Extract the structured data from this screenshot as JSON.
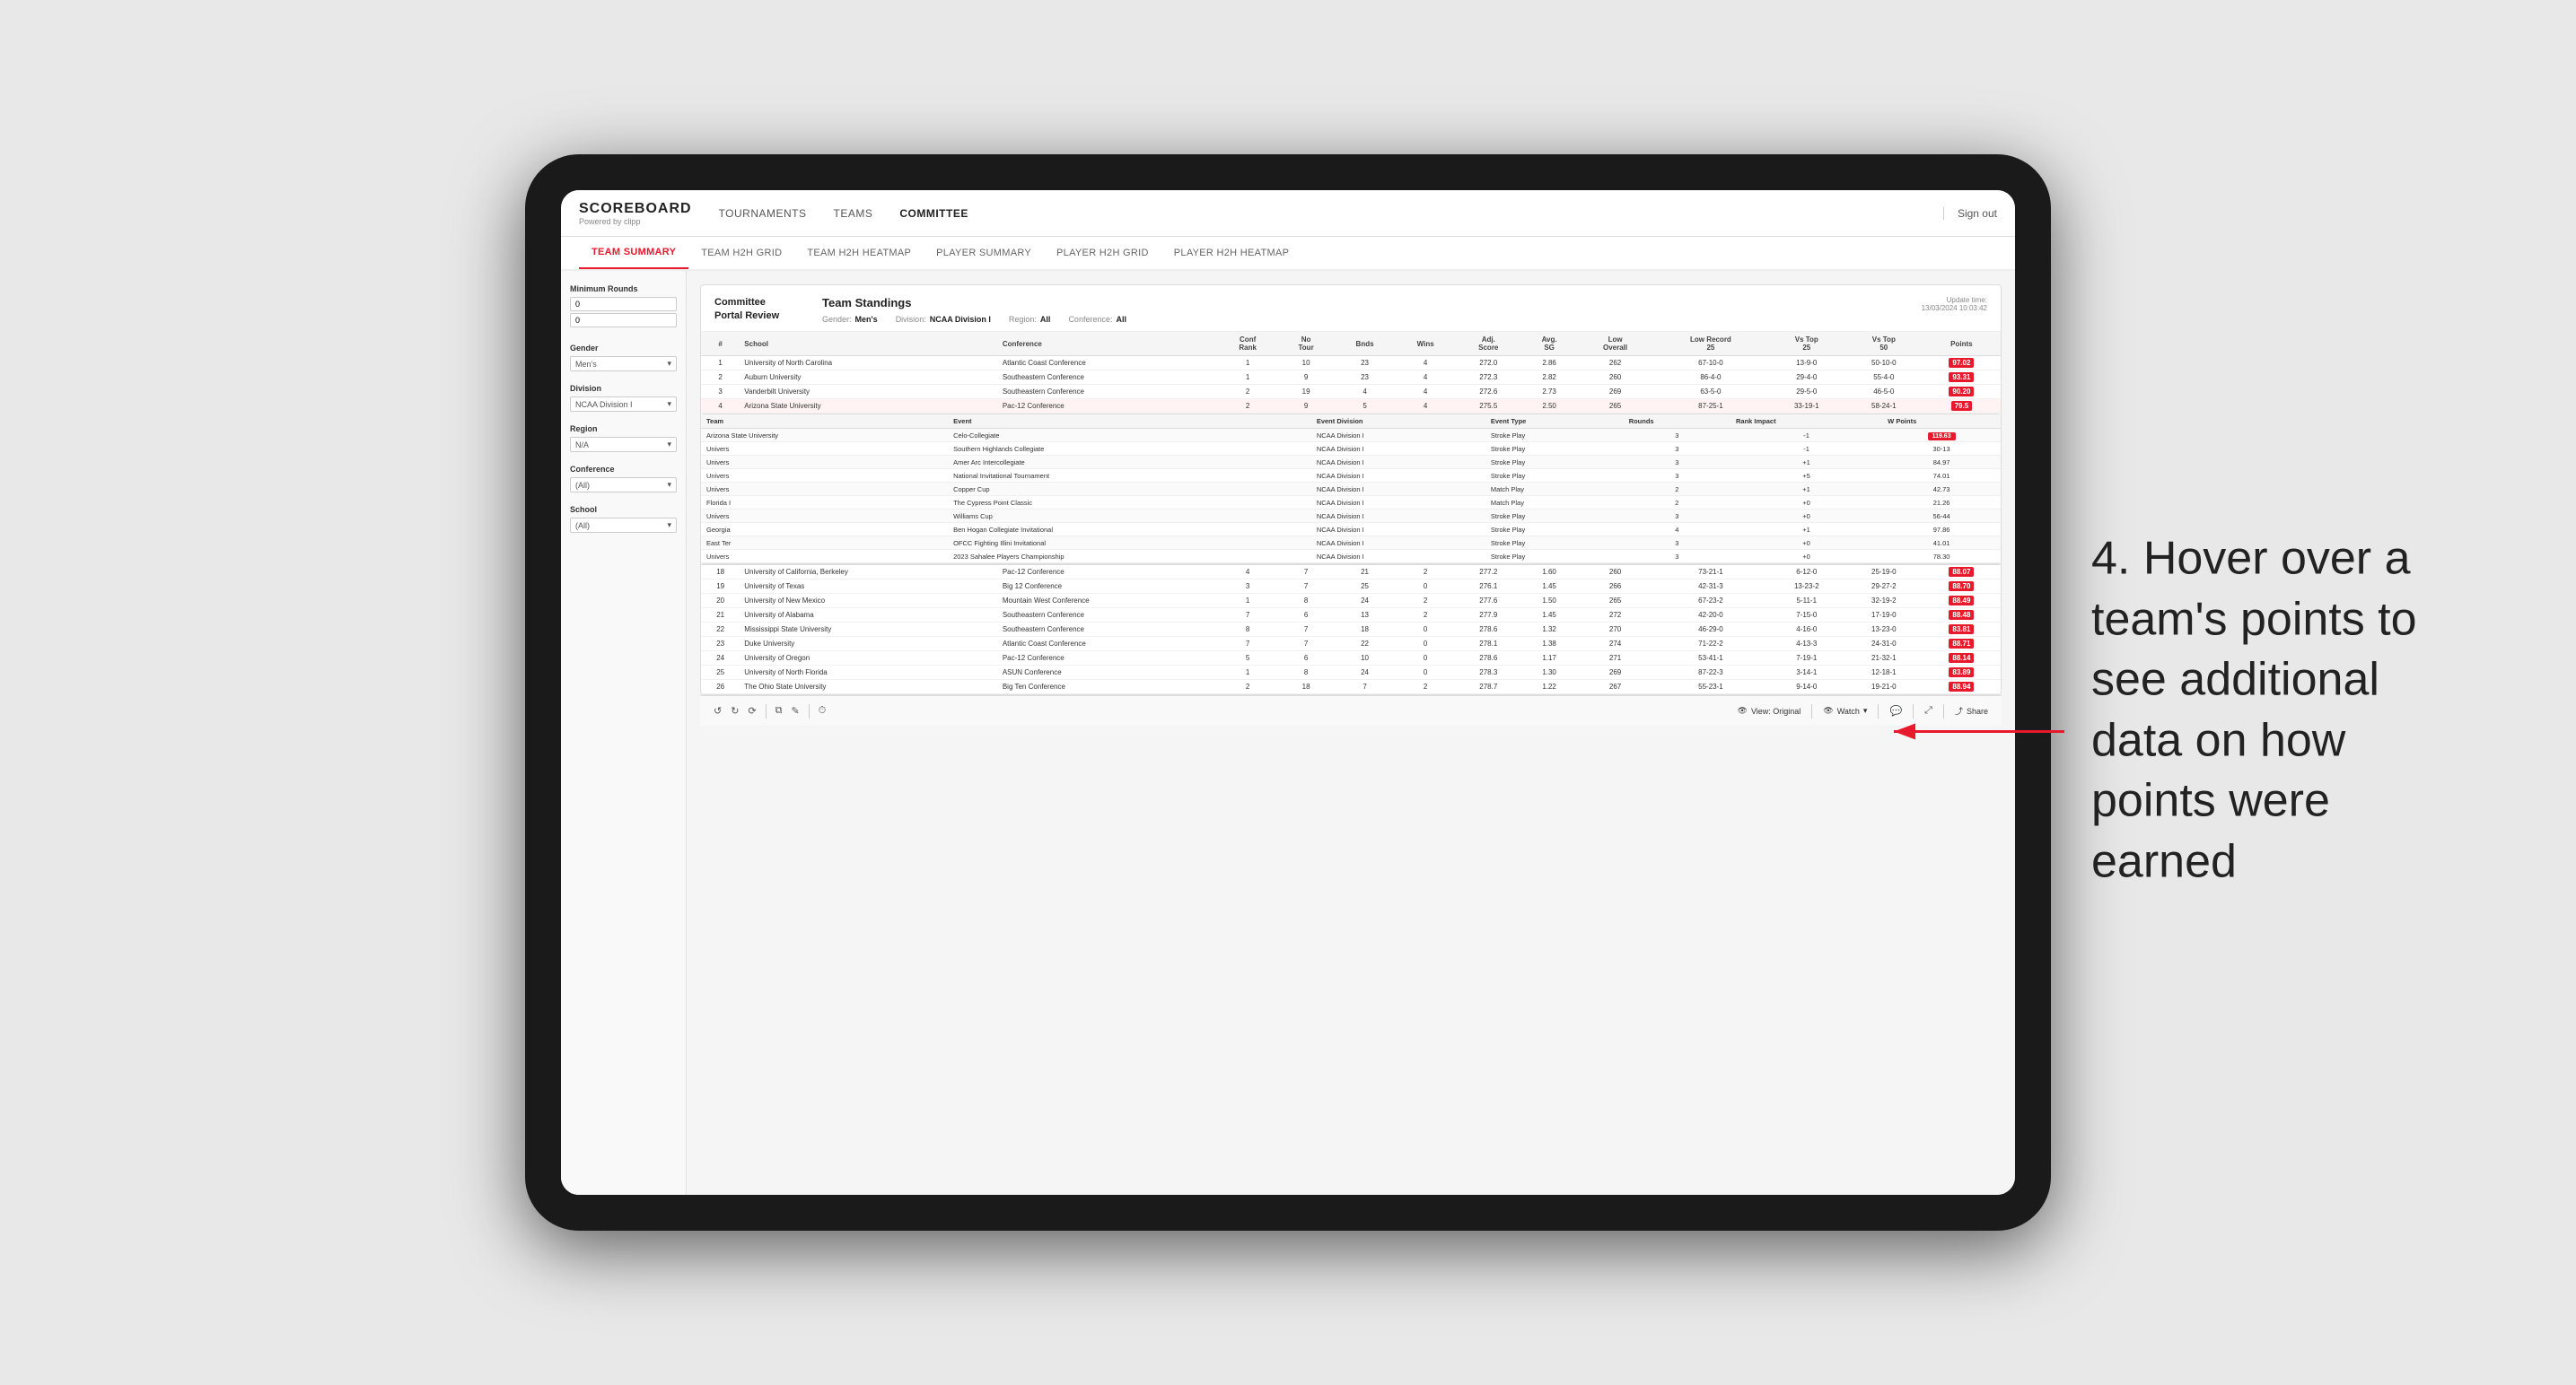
{
  "app": {
    "logo": "SCOREBOARD",
    "logo_sub": "Powered by clipp",
    "sign_out": "Sign out"
  },
  "nav": {
    "items": [
      {
        "label": "TOURNAMENTS",
        "active": false
      },
      {
        "label": "TEAMS",
        "active": false
      },
      {
        "label": "COMMITTEE",
        "active": true
      }
    ]
  },
  "sub_nav": {
    "items": [
      {
        "label": "TEAM SUMMARY",
        "active": true
      },
      {
        "label": "TEAM H2H GRID",
        "active": false
      },
      {
        "label": "TEAM H2H HEATMAP",
        "active": false
      },
      {
        "label": "PLAYER SUMMARY",
        "active": false
      },
      {
        "label": "PLAYER H2H GRID",
        "active": false
      },
      {
        "label": "PLAYER H2H HEATMAP",
        "active": false
      }
    ]
  },
  "sidebar": {
    "minimum_rounds_label": "Minimum Rounds",
    "minimum_rounds_value": "0",
    "gender_label": "Gender",
    "gender_value": "Men's",
    "division_label": "Division",
    "division_value": "NCAA Division I",
    "region_label": "Region",
    "region_value": "N/A",
    "conference_label": "Conference",
    "conference_value": "(All)",
    "school_label": "School",
    "school_value": "(All)"
  },
  "portal": {
    "title": "Committee\nPortal Review",
    "standings_title": "Team Standings",
    "update_time": "Update time:\n13/03/2024 10:03:42",
    "filters": {
      "gender_label": "Gender:",
      "gender_value": "Men's",
      "division_label": "Division:",
      "division_value": "NCAA Division I",
      "region_label": "Region:",
      "region_value": "All",
      "conference_label": "Conference:",
      "conference_value": "All"
    }
  },
  "table": {
    "headers": [
      "#",
      "School",
      "Conference",
      "Conf Rank",
      "No Tour",
      "Bnds",
      "Wins",
      "Adj. Score",
      "Avg. SG",
      "Low Overall",
      "Low Record 25",
      "Vs Top 25",
      "Vs Top 50",
      "Points"
    ],
    "rows": [
      {
        "rank": 1,
        "school": "University of North Carolina",
        "conference": "Atlantic Coast Conference",
        "conf_rank": 1,
        "no_tour": 10,
        "bnds": 23,
        "wins": 4,
        "adj_score": "272.0",
        "avg_sg": "2.86",
        "low_overall": "262",
        "low_record_25": "67-10-0",
        "vs_top_25": "13-9-0",
        "vs_top_50": "50-10-0",
        "points": "97.02",
        "highlighted": false
      },
      {
        "rank": 2,
        "school": "Auburn University",
        "conference": "Southeastern Conference",
        "conf_rank": 1,
        "no_tour": 9,
        "bnds": 23,
        "wins": 4,
        "adj_score": "272.3",
        "avg_sg": "2.82",
        "low_overall": "260",
        "low_record_25": "86-4-0",
        "vs_top_25": "29-4-0",
        "vs_top_50": "55-4-0",
        "points": "93.31",
        "highlighted": false
      },
      {
        "rank": 3,
        "school": "Vanderbilt University",
        "conference": "Southeastern Conference",
        "conf_rank": 2,
        "no_tour": 19,
        "bnds": 4,
        "wins": 4,
        "adj_score": "272.6",
        "avg_sg": "2.73",
        "low_overall": "269",
        "low_record_25": "63-5-0",
        "vs_top_25": "29-5-0",
        "vs_top_50": "46-5-0",
        "points": "90.20",
        "highlighted": false
      },
      {
        "rank": 4,
        "school": "Arizona State University",
        "conference": "Pac-12 Conference",
        "conf_rank": 2,
        "no_tour": 9,
        "bnds": 5,
        "wins": 4,
        "adj_score": "275.5",
        "avg_sg": "2.50",
        "low_overall": "265",
        "low_record_25": "87-25-1",
        "vs_top_25": "33-19-1",
        "vs_top_50": "58-24-1",
        "points": "79.5",
        "highlighted": true
      }
    ],
    "popup_rows": [
      {
        "team": "Arizona State\nUniversity",
        "event": "Celo-Collegiate",
        "event_division": "NCAA Division I",
        "event_type": "Stroke Play",
        "rounds": 3,
        "rank_impact": -1,
        "w_points": "119.63"
      },
      {
        "team": "Univers",
        "event": "Southern Highlands Collegiate",
        "event_division": "NCAA Division I",
        "event_type": "Stroke Play",
        "rounds": 3,
        "rank_impact": -1,
        "w_points": "30-13"
      },
      {
        "team": "Univers",
        "event": "Amer Arc Intercollegiate",
        "event_division": "NCAA Division I",
        "event_type": "Stroke Play",
        "rounds": 3,
        "rank_impact": "+1",
        "w_points": "84.97"
      },
      {
        "team": "Univers",
        "event": "National Invitational Tournament",
        "event_division": "NCAA Division I",
        "event_type": "Stroke Play",
        "rounds": 3,
        "rank_impact": "+5",
        "w_points": "74.01"
      },
      {
        "team": "Univers",
        "event": "Copper Cup",
        "event_division": "NCAA Division I",
        "event_type": "Match Play",
        "rounds": 2,
        "rank_impact": "+1",
        "w_points": "42.73"
      },
      {
        "team": "Florida I",
        "event": "The Cypress Point Classic",
        "event_division": "NCAA Division I",
        "event_type": "Match Play",
        "rounds": 2,
        "rank_impact": "+0",
        "w_points": "21.26"
      },
      {
        "team": "Univers",
        "event": "Williams Cup",
        "event_division": "NCAA Division I",
        "event_type": "Stroke Play",
        "rounds": 3,
        "rank_impact": "+0",
        "w_points": "56-44"
      },
      {
        "team": "Georgia",
        "event": "Ben Hogan Collegiate Invitational",
        "event_division": "NCAA Division I",
        "event_type": "Stroke Play",
        "rounds": 4,
        "rank_impact": "+1",
        "w_points": "97.86"
      },
      {
        "team": "East Ter",
        "event": "OFCC Fighting Illini Invitational",
        "event_division": "NCAA Division I",
        "event_type": "Stroke Play",
        "rounds": 3,
        "rank_impact": "+0",
        "w_points": "41.01"
      },
      {
        "team": "Univers",
        "event": "2023 Sahalee Players Championship",
        "event_division": "NCAA Division I",
        "event_type": "Stroke Play",
        "rounds": 3,
        "rank_impact": "+0",
        "w_points": "78.30"
      }
    ],
    "lower_rows": [
      {
        "rank": 18,
        "school": "University of California, Berkeley",
        "conference": "Pac-12 Conference",
        "conf_rank": 4,
        "no_tour": 7,
        "bnds": 21,
        "wins": 2,
        "adj_score": "277.2",
        "avg_sg": "1.60",
        "low_overall": "260",
        "low_record_25": "73-21-1",
        "vs_top_25": "6-12-0",
        "vs_top_50": "25-19-0",
        "points": "88.07"
      },
      {
        "rank": 19,
        "school": "University of Texas",
        "conference": "Big 12 Conference",
        "conf_rank": 3,
        "no_tour": 7,
        "bnds": 25,
        "wins": 0,
        "adj_score": "276.1",
        "avg_sg": "1.45",
        "low_overall": "266",
        "low_record_25": "42-31-3",
        "vs_top_25": "13-23-2",
        "vs_top_50": "29-27-2",
        "points": "88.70"
      },
      {
        "rank": 20,
        "school": "University of New Mexico",
        "conference": "Mountain West Conference",
        "conf_rank": 1,
        "no_tour": 8,
        "bnds": 24,
        "wins": 2,
        "adj_score": "277.6",
        "avg_sg": "1.50",
        "low_overall": "265",
        "low_record_25": "67-23-2",
        "vs_top_25": "5-11-1",
        "vs_top_50": "32-19-2",
        "points": "88.49"
      },
      {
        "rank": 21,
        "school": "University of Alabama",
        "conference": "Southeastern Conference",
        "conf_rank": 7,
        "no_tour": 6,
        "bnds": 13,
        "wins": 2,
        "adj_score": "277.9",
        "avg_sg": "1.45",
        "low_overall": "272",
        "low_record_25": "42-20-0",
        "vs_top_25": "7-15-0",
        "vs_top_50": "17-19-0",
        "points": "88.48"
      },
      {
        "rank": 22,
        "school": "Mississippi State University",
        "conference": "Southeastern Conference",
        "conf_rank": 8,
        "no_tour": 7,
        "bnds": 18,
        "wins": 0,
        "adj_score": "278.6",
        "avg_sg": "1.32",
        "low_overall": "270",
        "low_record_25": "46-29-0",
        "vs_top_25": "4-16-0",
        "vs_top_50": "13-23-0",
        "points": "83.81"
      },
      {
        "rank": 23,
        "school": "Duke University",
        "conference": "Atlantic Coast Conference",
        "conf_rank": 7,
        "no_tour": 7,
        "bnds": 22,
        "wins": 0,
        "adj_score": "278.1",
        "avg_sg": "1.38",
        "low_overall": "274",
        "low_record_25": "71-22-2",
        "vs_top_25": "4-13-3",
        "vs_top_50": "24-31-0",
        "points": "88.71"
      },
      {
        "rank": 24,
        "school": "University of Oregon",
        "conference": "Pac-12 Conference",
        "conf_rank": 5,
        "no_tour": 6,
        "bnds": 10,
        "wins": 0,
        "adj_score": "278.6",
        "avg_sg": "1.17",
        "low_overall": "271",
        "low_record_25": "53-41-1",
        "vs_top_25": "7-19-1",
        "vs_top_50": "21-32-1",
        "points": "88.14"
      },
      {
        "rank": 25,
        "school": "University of North Florida",
        "conference": "ASUN Conference",
        "conf_rank": 1,
        "no_tour": 8,
        "bnds": 24,
        "wins": 0,
        "adj_score": "278.3",
        "avg_sg": "1.30",
        "low_overall": "269",
        "low_record_25": "87-22-3",
        "vs_top_25": "3-14-1",
        "vs_top_50": "12-18-1",
        "points": "83.89"
      },
      {
        "rank": 26,
        "school": "The Ohio State University",
        "conference": "Big Ten Conference",
        "conf_rank": 2,
        "no_tour": 18,
        "bnds": 7,
        "wins": 2,
        "adj_score": "278.7",
        "avg_sg": "1.22",
        "low_overall": "267",
        "low_record_25": "55-23-1",
        "vs_top_25": "9-14-0",
        "vs_top_50": "19-21-0",
        "points": "88.94"
      }
    ]
  },
  "bottom_toolbar": {
    "view_label": "View: Original",
    "watch_label": "Watch",
    "share_label": "Share"
  },
  "annotation": {
    "text": "4. Hover over a team's points to see additional data on how points were earned"
  },
  "popup_table_headers": [
    "Team",
    "Event",
    "Event Division",
    "Event Type",
    "Rounds",
    "Rank Impact",
    "W Points"
  ]
}
